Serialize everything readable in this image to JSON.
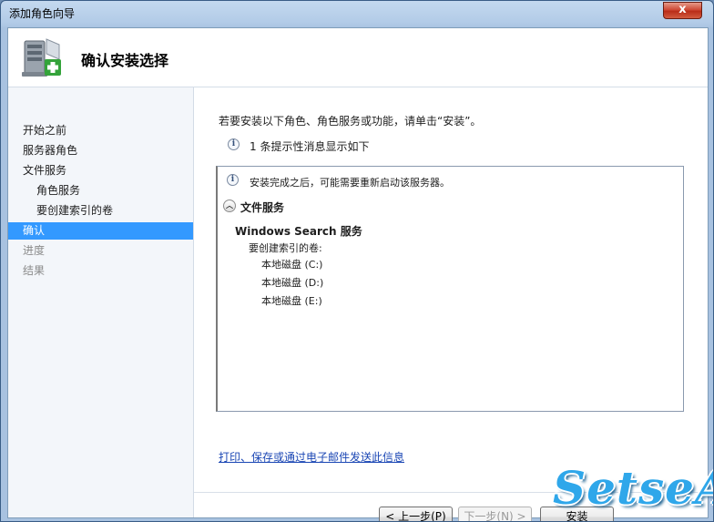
{
  "window": {
    "title": "添加角色向导",
    "close_label": "x"
  },
  "header": {
    "title": "确认安装选择",
    "icon": "server-add-icon"
  },
  "sidebar": {
    "steps": [
      {
        "label": "开始之前",
        "state": "normal"
      },
      {
        "label": "服务器角色",
        "state": "normal"
      },
      {
        "label": "文件服务",
        "state": "normal"
      },
      {
        "label": "角色服务",
        "state": "normal"
      },
      {
        "label": "要创建索引的卷",
        "state": "normal"
      },
      {
        "label": "确认",
        "state": "active"
      },
      {
        "label": "进度",
        "state": "disabled"
      },
      {
        "label": "结果",
        "state": "disabled"
      }
    ]
  },
  "main": {
    "instruction": "若要安装以下角色、角色服务或功能，请单击“安装”。",
    "message_count": "1 条提示性消息显示如下",
    "details": {
      "note": "安装完成之后，可能需要重新启动该服务器。",
      "section_title": "文件服务",
      "service_name": "Windows Search 服务",
      "volumes_label": "要创建索引的卷:",
      "volumes": [
        "本地磁盘 (C:)",
        "本地磁盘 (D:)",
        "本地磁盘 (E:)"
      ]
    },
    "link": "打印、保存或通过电子邮件发送此信息"
  },
  "buttons": {
    "back": "< 上一步(P)",
    "next": "下一步(N) >",
    "install": "安装"
  },
  "watermark": "SetseA",
  "colors": {
    "active_step": "#3399ff",
    "link": "#1a46b4",
    "watermark": "#2fa7ea"
  }
}
